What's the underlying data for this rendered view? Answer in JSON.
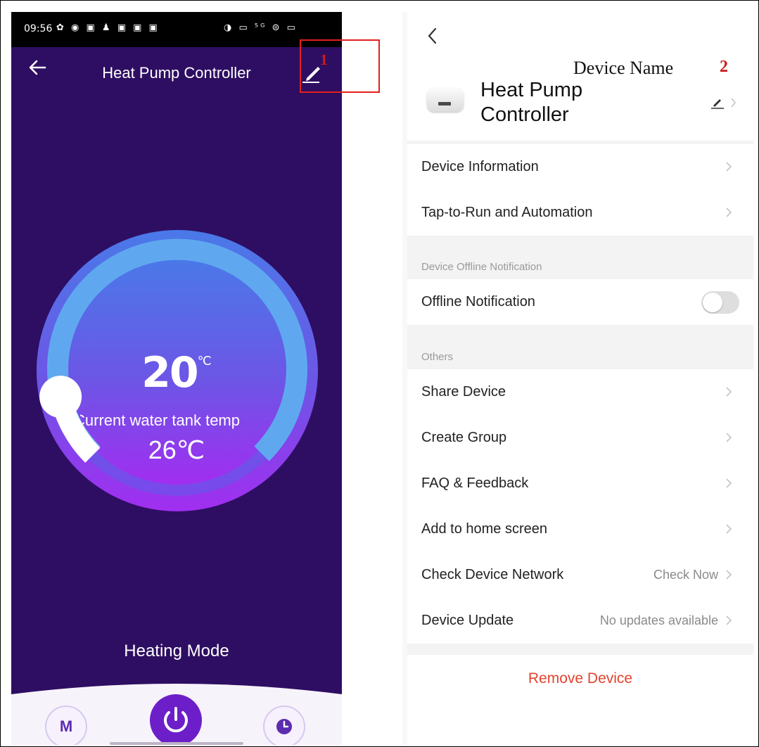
{
  "left_screen": {
    "status_bar": {
      "time": "09:56",
      "left_icons": "✿ ◉ ▣ ♟ ▣ ▣ ▣",
      "right_icons": "◑ ▭ ⁵ᴳ ⊜ ▭"
    },
    "header": {
      "title": "Heat Pump Controller",
      "back_icon": "back-arrow-icon",
      "edit_icon": "pencil-icon"
    },
    "thermostat": {
      "setpoint_value": "20",
      "setpoint_unit": "℃",
      "current_label": "Current water tank temp",
      "current_value": "26℃",
      "setpoint_fraction": 0.12
    },
    "mode_label": "Heating Mode",
    "bottom_buttons": {
      "mode": "M",
      "power_icon": "power-icon",
      "timer_icon": "clock-icon"
    },
    "colors": {
      "background": "#2e0e62",
      "dial_top": "#4a79e8",
      "dial_bottom": "#a12ef0",
      "power": "#6c1fc9"
    }
  },
  "annotations": {
    "marker_1": "1",
    "caption": "Device Name",
    "marker_2": "2"
  },
  "right_screen": {
    "back_icon": "chevron-left-icon",
    "device_name": "Heat Pump Controller",
    "rows_top": [
      {
        "label": "Device Information"
      },
      {
        "label": "Tap-to-Run and Automation"
      }
    ],
    "offline_section": {
      "header": "Device Offline Notification",
      "row": {
        "label": "Offline Notification",
        "toggle_on": false
      }
    },
    "others_section": {
      "header": "Others",
      "rows": [
        {
          "label": "Share Device",
          "value": ""
        },
        {
          "label": "Create Group",
          "value": ""
        },
        {
          "label": "FAQ & Feedback",
          "value": ""
        },
        {
          "label": "Add to home screen",
          "value": ""
        },
        {
          "label": "Check Device Network",
          "value": "Check Now"
        },
        {
          "label": "Device Update",
          "value": "No updates available"
        }
      ]
    },
    "remove_label": "Remove Device",
    "colors": {
      "remove": "#e5432f",
      "background": "#f3f3f3"
    }
  }
}
